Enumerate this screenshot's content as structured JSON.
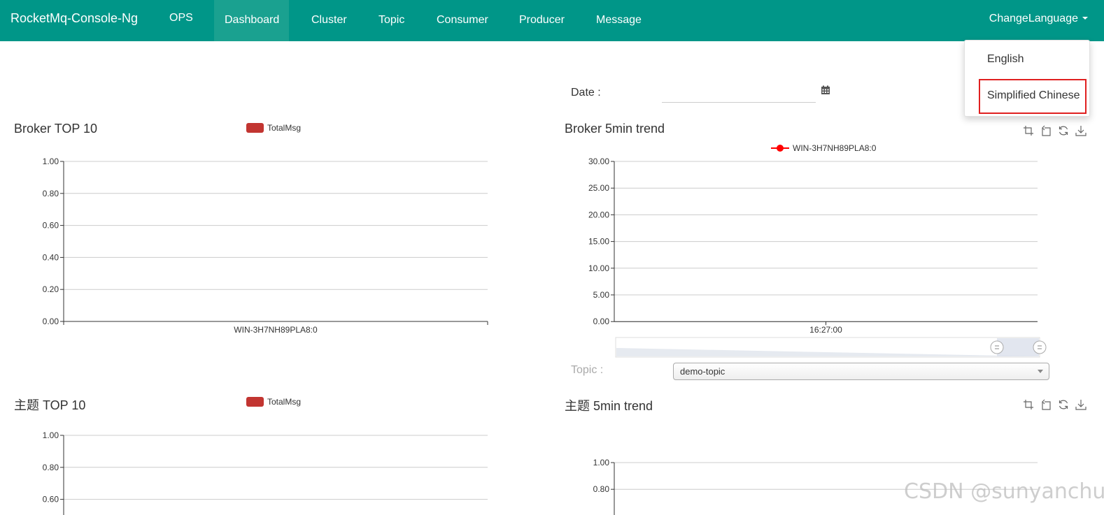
{
  "navbar": {
    "brand": "RocketMq-Console-Ng",
    "items": [
      "OPS",
      "Dashboard",
      "Cluster",
      "Topic",
      "Consumer",
      "Producer",
      "Message"
    ],
    "active": "Dashboard",
    "language_label": "ChangeLanguage"
  },
  "language_menu": {
    "options": [
      "English",
      "Simplified Chinese"
    ],
    "highlighted": "Simplified Chinese"
  },
  "filters": {
    "date_label": "Date :",
    "date_value": "",
    "topic_label": "Topic :",
    "topic_value": "demo-topic"
  },
  "colors": {
    "nav": "#009688",
    "series": "#c23531",
    "highlight": "#e02020"
  },
  "toolbox_icons": [
    "data-zoom-icon",
    "zoom-reset-icon",
    "restore-icon",
    "save-image-icon"
  ],
  "chart_data": [
    {
      "type": "bar",
      "title": "Broker TOP 10",
      "legend": [
        "TotalMsg"
      ],
      "categories": [
        "WIN-3H7NH89PLA8:0"
      ],
      "series": [
        {
          "name": "TotalMsg",
          "values": []
        }
      ],
      "ylim": [
        0,
        1
      ],
      "yticks": [
        "1.00",
        "0.80",
        "0.60",
        "0.40",
        "0.20",
        "0.00"
      ],
      "grid": true
    },
    {
      "type": "line",
      "title": "Broker 5min trend",
      "legend": [
        "WIN-3H7NH89PLA8:0"
      ],
      "x": [
        "16:27:00"
      ],
      "series": [
        {
          "name": "WIN-3H7NH89PLA8:0",
          "values": []
        }
      ],
      "ylim": [
        0,
        30
      ],
      "yticks": [
        "30.00",
        "25.00",
        "20.00",
        "15.00",
        "10.00",
        "5.00",
        "0.00"
      ],
      "grid": true,
      "data_zoom": true
    },
    {
      "type": "bar",
      "title": "主题 TOP 10",
      "legend": [
        "TotalMsg"
      ],
      "categories": [],
      "series": [
        {
          "name": "TotalMsg",
          "values": []
        }
      ],
      "ylim": [
        0,
        1
      ],
      "yticks": [
        "1.00",
        "0.80",
        "0.60"
      ],
      "grid": true
    },
    {
      "type": "line",
      "title": "主题 5min trend",
      "legend": [],
      "series": [],
      "ylim": [
        0,
        1
      ],
      "yticks": [
        "1.00",
        "0.80"
      ],
      "grid": true
    }
  ],
  "watermark": "CSDN @sunyanchun"
}
